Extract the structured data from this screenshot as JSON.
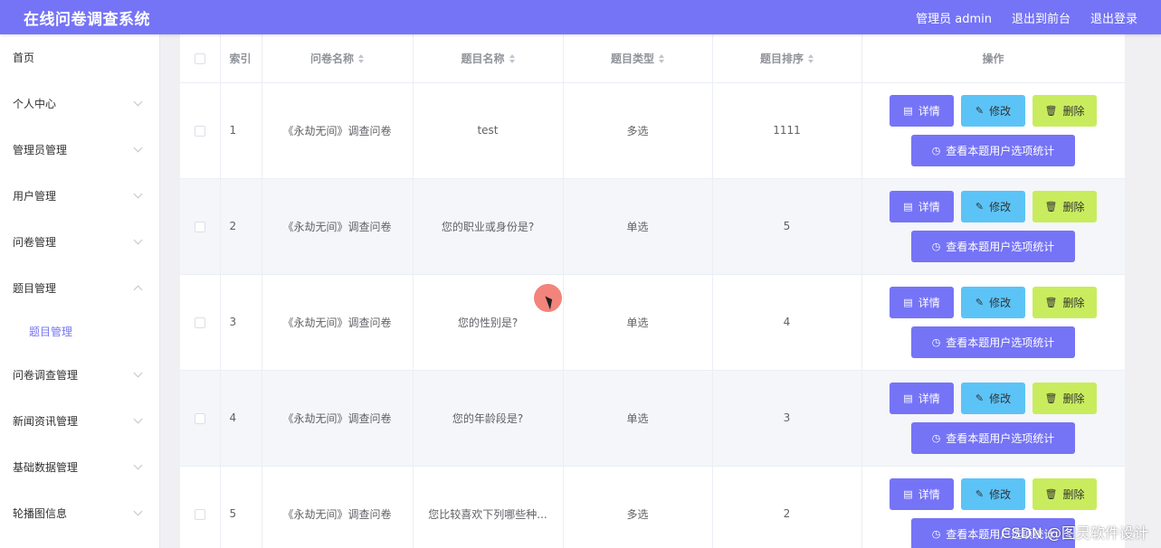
{
  "header": {
    "title": "在线问卷调查系统",
    "user": "管理员 admin",
    "back_to_front": "退出到前台",
    "logout": "退出登录"
  },
  "sidebar": {
    "items": [
      {
        "label": "首页",
        "expandable": false
      },
      {
        "label": "个人中心",
        "expandable": true
      },
      {
        "label": "管理员管理",
        "expandable": true
      },
      {
        "label": "用户管理",
        "expandable": true
      },
      {
        "label": "问卷管理",
        "expandable": true
      },
      {
        "label": "题目管理",
        "expandable": true,
        "expanded": true
      },
      {
        "label": "问卷调查管理",
        "expandable": true
      },
      {
        "label": "新闻资讯管理",
        "expandable": true
      },
      {
        "label": "基础数据管理",
        "expandable": true
      },
      {
        "label": "轮播图信息",
        "expandable": true
      }
    ],
    "active_sub": "题目管理"
  },
  "table": {
    "headers": {
      "index": "索引",
      "survey_name": "问卷名称",
      "question_name": "题目名称",
      "question_type": "题目类型",
      "question_order": "题目排序",
      "actions": "操作"
    },
    "rows": [
      {
        "index": "1",
        "survey_name": "《永劫无间》调查问卷",
        "question_name": "test",
        "question_type": "多选",
        "question_order": "1111"
      },
      {
        "index": "2",
        "survey_name": "《永劫无间》调查问卷",
        "question_name": "您的职业或身份是?",
        "question_type": "单选",
        "question_order": "5"
      },
      {
        "index": "3",
        "survey_name": "《永劫无间》调查问卷",
        "question_name": "您的性别是?",
        "question_type": "单选",
        "question_order": "4"
      },
      {
        "index": "4",
        "survey_name": "《永劫无间》调查问卷",
        "question_name": "您的年龄段是?",
        "question_type": "单选",
        "question_order": "3"
      },
      {
        "index": "5",
        "survey_name": "《永劫无间》调查问卷",
        "question_name": "您比较喜欢下列哪些种...",
        "question_type": "多选",
        "question_order": "2"
      }
    ],
    "buttons": {
      "detail": "详情",
      "edit": "修改",
      "delete": "删除",
      "stats": "查看本题用户选项统计"
    }
  },
  "watermark": "CSDN @图灵软件设计",
  "colors": {
    "primary": "#7574f6",
    "edit": "#5cc3f7",
    "delete": "#c9ec5e"
  }
}
